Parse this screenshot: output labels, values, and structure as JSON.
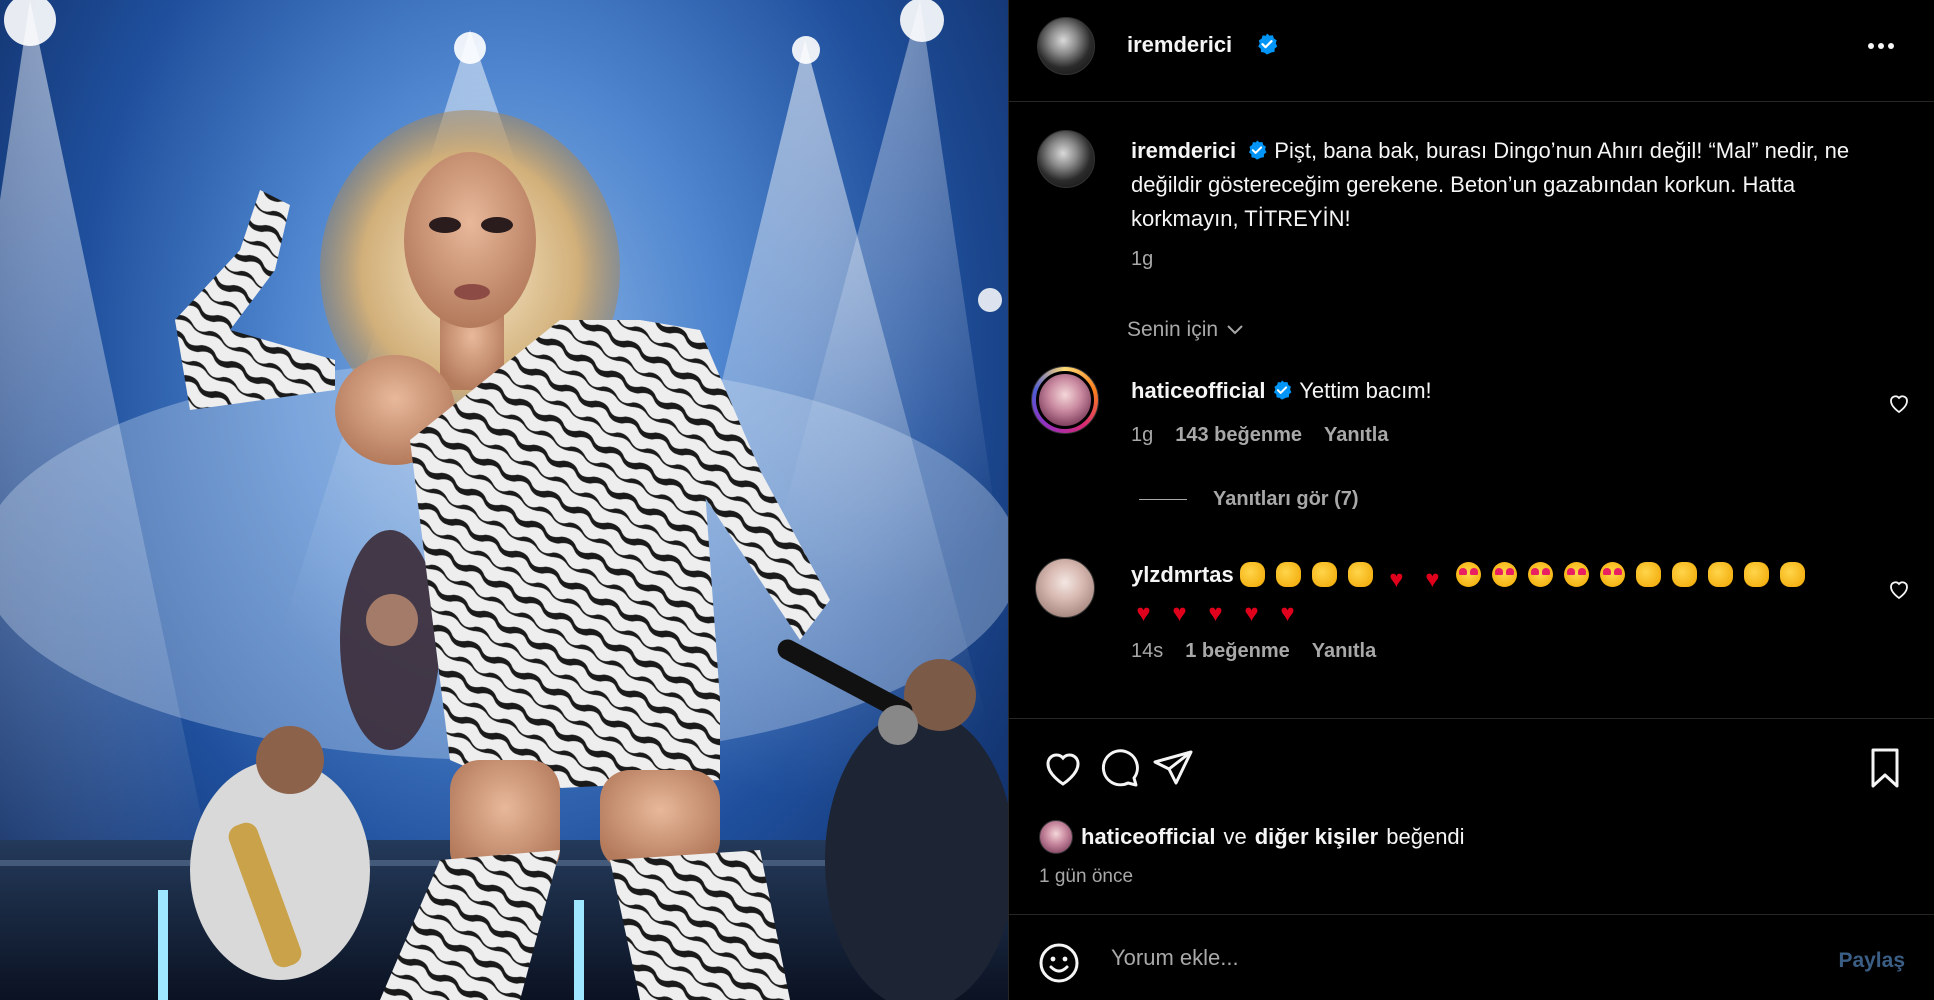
{
  "post": {
    "author": "iremderici",
    "verified": true,
    "caption": "Pişt, bana bak, burası Dingo’nun Ahırı değil! “Mal” nedir, ne değildir göstereceğim gerekene. Beton’un gazabından korkun. Hatta korkmayın, TİTREYİN!",
    "caption_time": "1g",
    "more_icon": "more-horizontal-icon"
  },
  "for_you": {
    "label": "Senin için",
    "icon": "chevron-down-icon"
  },
  "comments": [
    {
      "username": "haticeofficial",
      "verified": true,
      "text": "Yettim bacım!",
      "time": "1g",
      "likes": "143 beğenme",
      "reply": "Yanıtla",
      "view_replies": "Yanıtları gör (7)"
    },
    {
      "username": "ylzdmrtas",
      "emoji_line1": [
        "clap",
        "clap",
        "clap",
        "clap",
        "heart",
        "heart",
        "star",
        "star",
        "star",
        "star",
        "star",
        "clap",
        "clap",
        "clap",
        "clap",
        "clap"
      ],
      "emoji_line2": [
        "heart",
        "heart",
        "heart",
        "heart",
        "heart"
      ],
      "time": "14s",
      "likes": "1 beğenme",
      "reply": "Yanıtla"
    }
  ],
  "actions": [
    "heart-icon",
    "comment-icon",
    "share-icon",
    "bookmark-icon"
  ],
  "liked_by": {
    "user": "haticeofficial",
    "connector": "ve",
    "others": "diğer kişiler",
    "suffix": "beğendi"
  },
  "post_date": "1 gün önce",
  "comment_box": {
    "placeholder": "Yorum ekle...",
    "submit": "Paylaş"
  },
  "colors": {
    "background": "#000000",
    "text": "#f5f5f5",
    "muted": "#a8a8a8",
    "verified": "#0095f6",
    "share_disabled": "#3b5e85"
  }
}
